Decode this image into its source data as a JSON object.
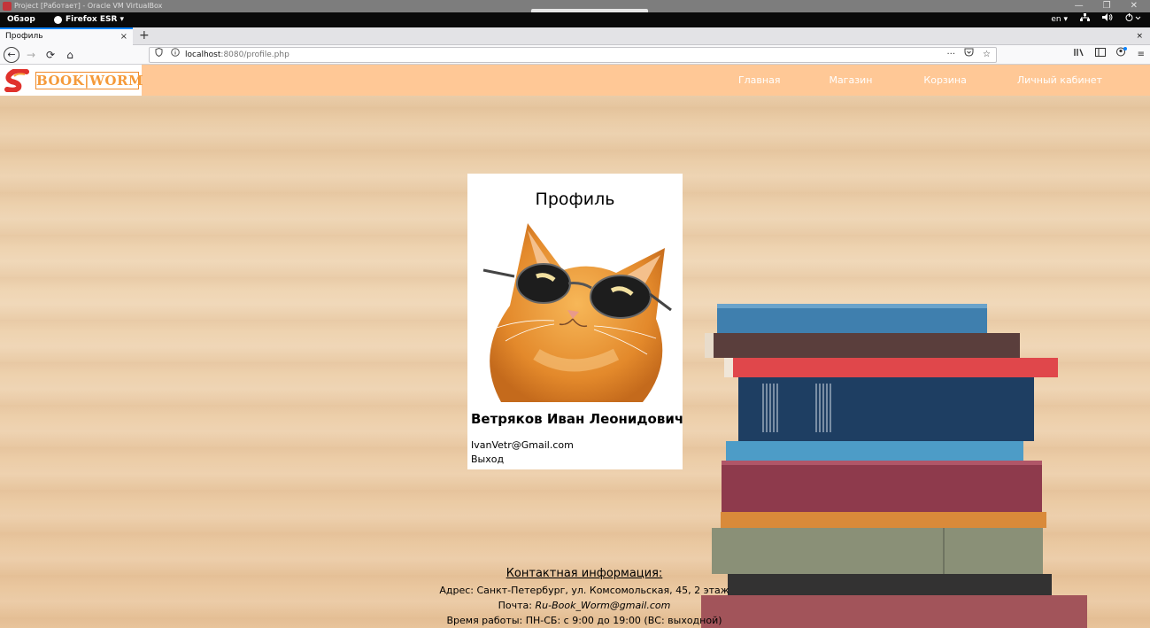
{
  "vbox": {
    "title": "Project [Работает] - Oracle VM VirtualBox",
    "controls": [
      "—",
      "❐",
      "✕"
    ]
  },
  "gnome": {
    "activities": "Обзор",
    "app_menu": "Firefox ESR ▾",
    "lang": "en ▾"
  },
  "browser": {
    "tab_title": "Профиль",
    "tab_close": "×",
    "new_tab": "+",
    "strip_close": "×",
    "url_host": "localhost",
    "url_rest": ":8080/profile.php",
    "url_more": "···"
  },
  "site": {
    "logo_text": "BOOK|WORM",
    "menu": [
      "Главная",
      "Магазин",
      "Корзина",
      "Личный кабинет"
    ]
  },
  "profile": {
    "title": "Профиль",
    "full_name": "Ветряков Иван Леонидович",
    "email": "IvanVetr@Gmail.com",
    "logout": "Выход"
  },
  "contact": {
    "title": "Контактная информация:",
    "address_label": "Адрес:",
    "address_value": "Санкт-Петербург, ул. Комсомольская, 45, 2 этаж",
    "mail_label": "Почта:",
    "mail_value": "Ru-Book_Worm@gmail.com",
    "hours_label": "Время работы:",
    "hours_value": "ПН-СБ: с 9:00 до 19:00 (ВС: выходной)"
  },
  "colors": {
    "header_bg": "#ffc896",
    "logo_orange": "#f59a3a",
    "firefox_accent": "#0a84ff"
  }
}
